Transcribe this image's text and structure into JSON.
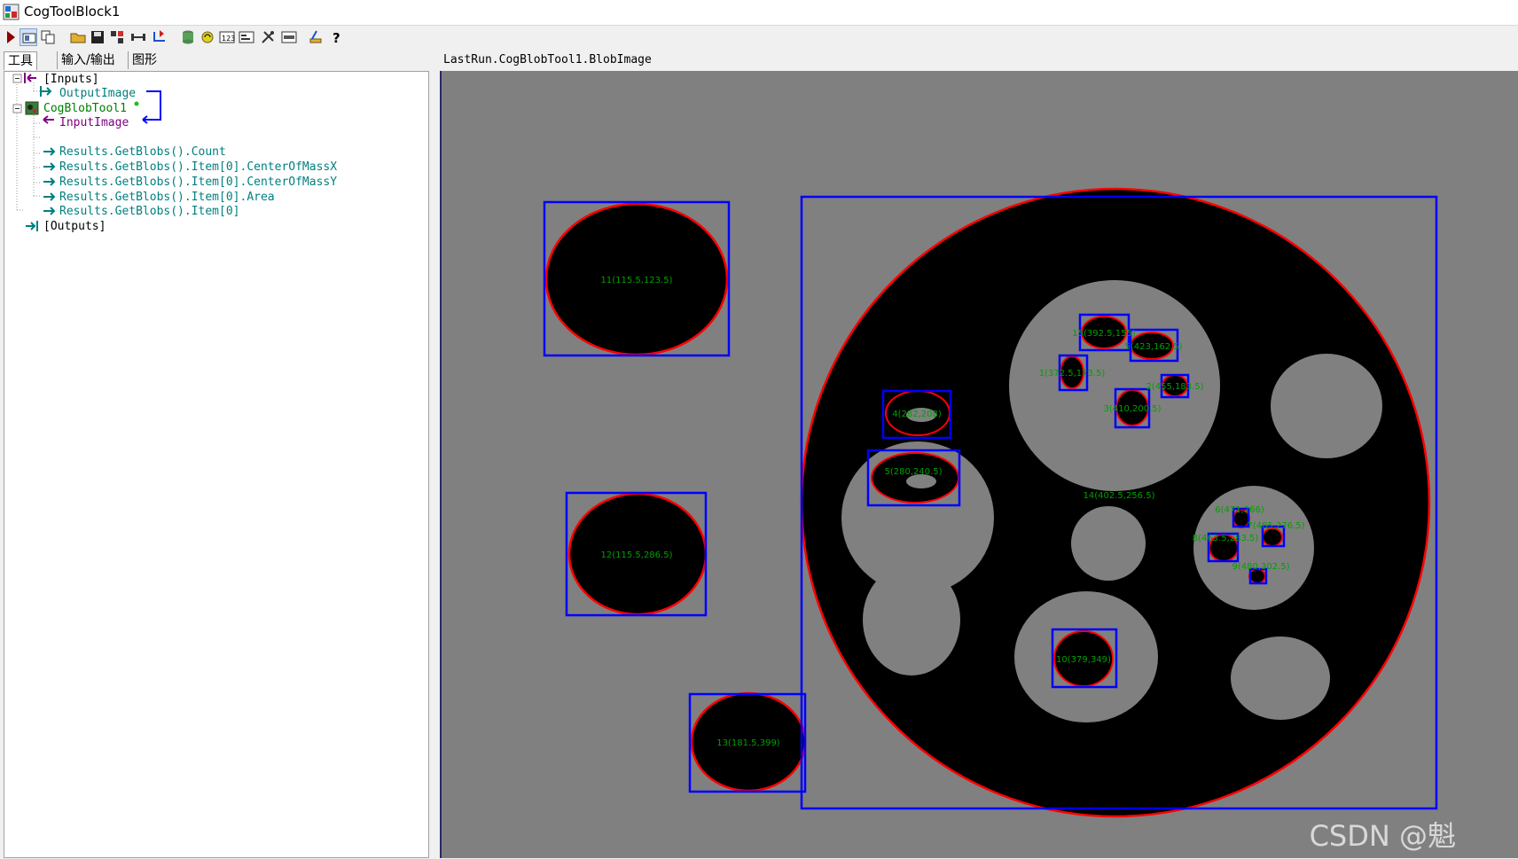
{
  "window": {
    "title": "CogToolBlock1"
  },
  "tabs": [
    {
      "label": "工具"
    },
    {
      "label": "输入/输出"
    },
    {
      "label": "图形"
    }
  ],
  "tree": {
    "inputs_label": "[Inputs]",
    "output_image_label": "OutputImage",
    "blob_tool_label": "CogBlobTool1",
    "input_image_label": "InputImage",
    "results": [
      "Results.GetBlobs().Count",
      "Results.GetBlobs().Item[0].CenterOfMassX",
      "Results.GetBlobs().Item[0].CenterOfMassY",
      "Results.GetBlobs().Item[0].Area",
      "Results.GetBlobs().Item[0]"
    ],
    "outputs_label": "[Outputs]"
  },
  "image": {
    "header": "LastRun.CogBlobTool1.BlobImage",
    "blob_labels": [
      "11(115.5,123.5)",
      "12(115.5,286.5)",
      "13(181.5,399)",
      "14(402.5,256.5)",
      "15(392.5,155)",
      "5(423,162.5)",
      "1(372.5,173.5)",
      "2(455,183.5)",
      "3(410,200.5)",
      "4(282,208)",
      "5(280,240.5)",
      "6(471,266)",
      "7(485,276.5)",
      "8(463.5,283.5)",
      "9(480,302.5)",
      "10(379,349)"
    ]
  },
  "watermark": "CSDN @魁",
  "colors": {
    "blob_box": "#0000ff",
    "contour": "#ff0000",
    "label": "#00a000",
    "image_bg": "#808080",
    "tree_teal": "#007f7f",
    "tree_purple": "#800080"
  }
}
